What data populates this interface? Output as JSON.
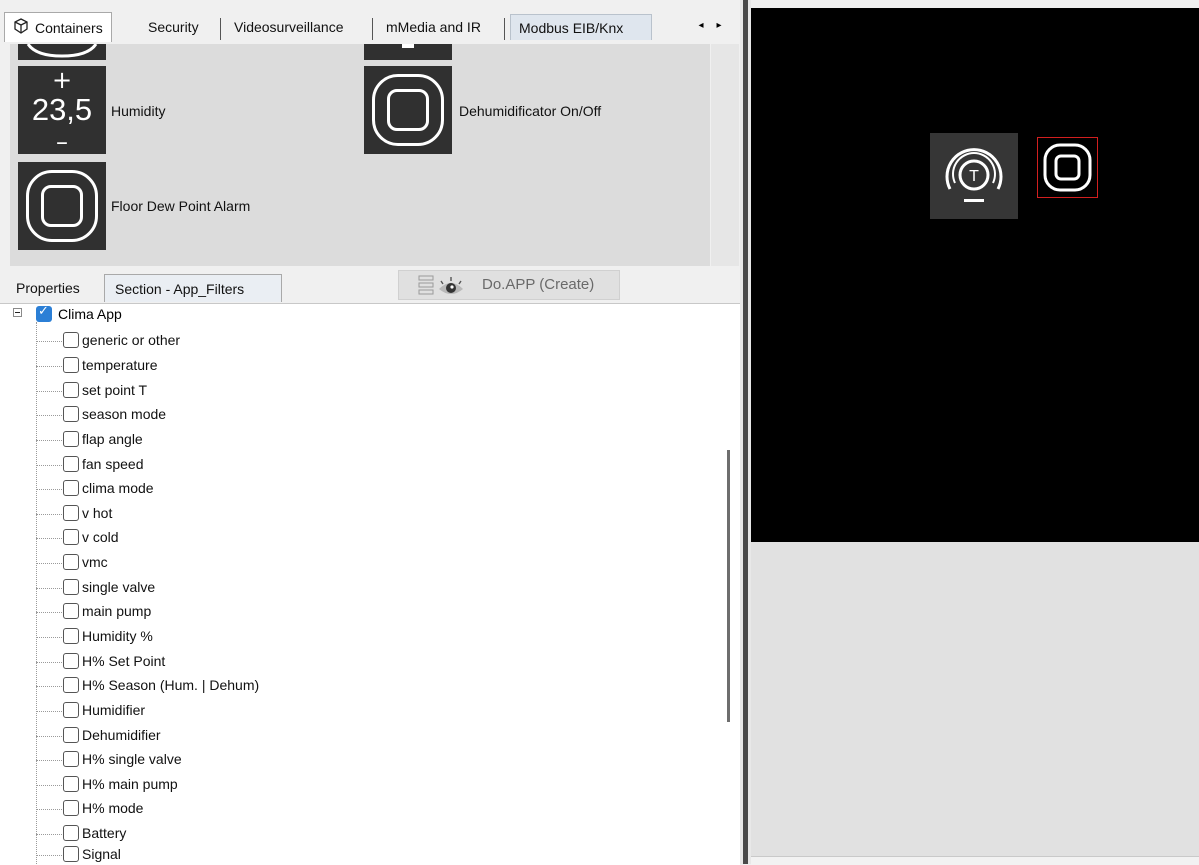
{
  "tabs": {
    "items": [
      {
        "label": "Containers"
      },
      {
        "label": "Security"
      },
      {
        "label": "Videosurveillance"
      },
      {
        "label": "mMedia and IR"
      },
      {
        "label": "Modbus EIB/Knx"
      }
    ],
    "active_index": 4,
    "scroll_left": "◂",
    "scroll_right": "▸"
  },
  "gallery": {
    "widgets": [
      {
        "label": "Humidity",
        "icon": "number-stepper-icon",
        "value": "23,5",
        "plus": "+",
        "minus": "–"
      },
      {
        "label": "Dehumidificator On/Off",
        "icon": "square-button-icon"
      },
      {
        "label": "Floor Dew Point Alarm",
        "icon": "square-button-icon"
      }
    ]
  },
  "properties_tabs": {
    "properties_label": "Properties",
    "section_label": "Section - App_Filters",
    "do_app_label": "Do.APP (Create)",
    "do_app_icon": "eye-icon"
  },
  "tree": {
    "root": {
      "label": "Clima App",
      "checked": true
    },
    "items": [
      {
        "label": "generic or other",
        "checked": false
      },
      {
        "label": "temperature",
        "checked": false
      },
      {
        "label": "set point T",
        "checked": false
      },
      {
        "label": "season mode",
        "checked": false
      },
      {
        "label": "flap angle",
        "checked": false
      },
      {
        "label": "fan speed",
        "checked": false
      },
      {
        "label": "clima mode",
        "checked": false
      },
      {
        "label": "v hot",
        "checked": false
      },
      {
        "label": "v cold",
        "checked": false
      },
      {
        "label": "vmc",
        "checked": false
      },
      {
        "label": "single valve",
        "checked": false
      },
      {
        "label": "main pump",
        "checked": false
      },
      {
        "label": "Humidity %",
        "checked": false
      },
      {
        "label": "H% Set Point",
        "checked": false
      },
      {
        "label": "H% Season (Hum. | Dehum)",
        "checked": false
      },
      {
        "label": "Humidifier",
        "checked": false
      },
      {
        "label": "Dehumidifier",
        "checked": false
      },
      {
        "label": "H% single valve",
        "checked": false
      },
      {
        "label": "H% main pump",
        "checked": false
      },
      {
        "label": "H% mode",
        "checked": false
      },
      {
        "label": "Battery",
        "checked": false
      },
      {
        "label": "Signal",
        "checked": false
      }
    ]
  },
  "preview": {
    "canvas_items": [
      {
        "icon": "thermostat-gauge-icon",
        "gauge_letter": "T"
      },
      {
        "icon": "square-button-icon",
        "selected": true
      }
    ],
    "colors": {
      "canvas_bg": "#000000",
      "selection": "#d21f1f",
      "checkbox_checked": "#2b7fd6"
    }
  }
}
